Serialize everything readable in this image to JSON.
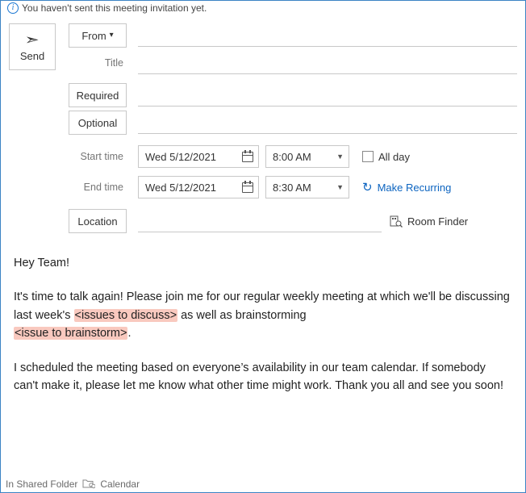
{
  "info_bar": {
    "text": "You haven't sent this meeting invitation yet."
  },
  "send": {
    "label": "Send"
  },
  "fields": {
    "from_label": "From",
    "title_label": "Title",
    "required_label": "Required",
    "optional_label": "Optional",
    "start_label": "Start time",
    "end_label": "End time",
    "location_label": "Location",
    "from_value": "",
    "title_value": "",
    "required_value": "",
    "optional_value": "",
    "location_value": ""
  },
  "times": {
    "start_date": "Wed 5/12/2021",
    "start_time": "8:00 AM",
    "end_date": "Wed 5/12/2021",
    "end_time": "8:30 AM",
    "allday_label": "All day",
    "allday_checked": false,
    "recurring_label": "Make Recurring"
  },
  "room_finder": {
    "label": "Room Finder"
  },
  "body": {
    "p1": "Hey Team!",
    "p2_pre": "It's time to talk again! Please join me for our regular weekly meeting at which we'll be discussing last week's ",
    "p2_ph1": "<issues to discuss>",
    "p2_mid": " as well as brainstorming ",
    "p2_ph2": "<issue to brainstorm>",
    "p2_post": ".",
    "p3": "I scheduled the meeting based on everyone’s availability in our team calendar. If somebody can't make it, please let me know what other time might work. Thank you all and see you soon!"
  },
  "footer": {
    "shared_label": "In Shared Folder",
    "calendar_label": "Calendar"
  }
}
